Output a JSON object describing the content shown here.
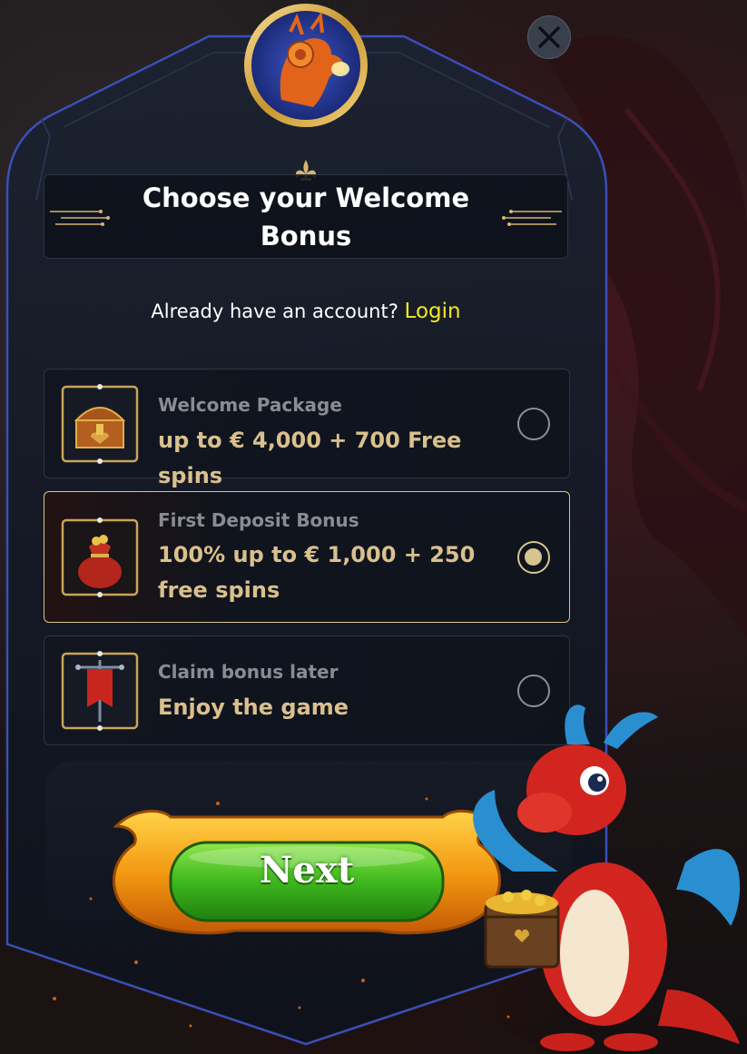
{
  "modal": {
    "title": "Choose your Welcome Bonus",
    "login_prompt": "Already have an account?",
    "login_link": "Login",
    "close_icon": "close-icon",
    "emblem_icon": "dragon-emblem-icon"
  },
  "options": [
    {
      "label": "Welcome Package",
      "value": "up to € 4,000 + 700 Free spins",
      "icon": "treasure-chest-icon",
      "selected": false
    },
    {
      "label": "First Deposit Bonus",
      "value": "100% up to € 1,000 + 250 free spins",
      "icon": "money-bag-icon",
      "selected": true
    },
    {
      "label": "Claim bonus later",
      "value": "Enjoy the game",
      "icon": "banner-flag-icon",
      "selected": false
    }
  ],
  "next_button": {
    "label": "Next"
  },
  "colors": {
    "accent_gold": "#d9c08d",
    "login_yellow": "#f2e81f",
    "frame_blue": "#3b4fb8",
    "button_green": "#3fb81e"
  }
}
